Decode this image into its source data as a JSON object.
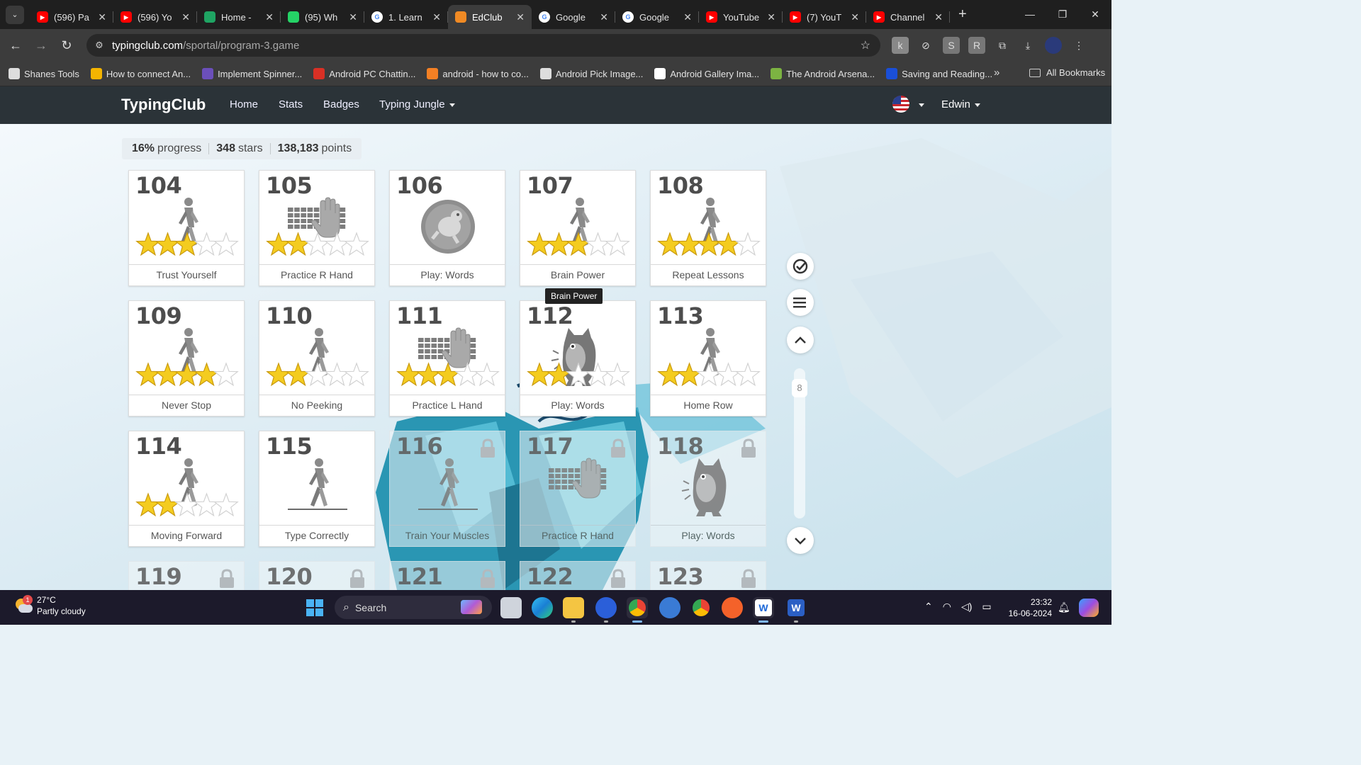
{
  "browser": {
    "tabs": [
      {
        "title": "(596) Pa",
        "fav": "youtube",
        "color": "#ff0000"
      },
      {
        "title": "(596) Yo",
        "fav": "youtube",
        "color": "#ff0000"
      },
      {
        "title": "Home -",
        "fav": "drive",
        "color": "#1fa463"
      },
      {
        "title": "(95) Wh",
        "fav": "whatsapp",
        "color": "#25d366"
      },
      {
        "title": "1. Learn",
        "fav": "google",
        "color": "#4285f4"
      },
      {
        "title": "EdClub",
        "fav": "edclub",
        "color": "#f08a24",
        "active": true
      },
      {
        "title": "Google",
        "fav": "google",
        "color": "#4285f4"
      },
      {
        "title": "Google",
        "fav": "google",
        "color": "#4285f4"
      },
      {
        "title": "YouTube",
        "fav": "youtube",
        "color": "#ff0000"
      },
      {
        "title": "(7) YouT",
        "fav": "youtube",
        "color": "#ff0000"
      },
      {
        "title": "Channel",
        "fav": "youtube",
        "color": "#ff0000"
      }
    ],
    "url_domain": "typingclub.com",
    "url_path": "/sportal/program-3.game",
    "bookmarks": [
      {
        "label": "Shanes Tools",
        "color": "#dddddd"
      },
      {
        "label": "How to connect An...",
        "color": "#f4b400"
      },
      {
        "label": "Implement Spinner...",
        "color": "#6b4fbb"
      },
      {
        "label": "Android  PC Chattin...",
        "color": "#d93025"
      },
      {
        "label": "android - how to co...",
        "color": "#f48024"
      },
      {
        "label": "Android Pick Image...",
        "color": "#dddddd"
      },
      {
        "label": "Android Gallery Ima...",
        "color": "#ffffff"
      },
      {
        "label": "The Android Arsena...",
        "color": "#7cb342"
      },
      {
        "label": "Saving and Reading...",
        "color": "#1a4fd8"
      }
    ],
    "all_bookmarks": "All Bookmarks"
  },
  "site": {
    "brand": "TypingClub",
    "nav": [
      "Home",
      "Stats",
      "Badges",
      "Typing Jungle"
    ],
    "user": "Edwin"
  },
  "progress": {
    "percent": "16%",
    "percent_label": "progress",
    "stars": "348",
    "stars_label": "stars",
    "points": "138,183",
    "points_label": "points"
  },
  "lessons": [
    {
      "num": "104",
      "label": "Trust Yourself",
      "type": "walker",
      "stars": 3,
      "locked": false
    },
    {
      "num": "105",
      "label": "Practice R Hand",
      "type": "keyboard",
      "stars": 2,
      "locked": false
    },
    {
      "num": "106",
      "label": "Play: Words",
      "type": "game",
      "stars": 0,
      "locked": false
    },
    {
      "num": "107",
      "label": "Brain Power",
      "type": "walker",
      "stars": 3,
      "locked": false
    },
    {
      "num": "108",
      "label": "Repeat Lessons",
      "type": "walker",
      "stars": 4,
      "locked": false
    },
    {
      "num": "109",
      "label": "Never Stop",
      "type": "walker",
      "stars": 4,
      "locked": false
    },
    {
      "num": "110",
      "label": "No Peeking",
      "type": "walker",
      "stars": 2,
      "locked": false
    },
    {
      "num": "111",
      "label": "Practice L Hand",
      "type": "keyboard",
      "stars": 3,
      "locked": false
    },
    {
      "num": "112",
      "label": "Play: Words",
      "type": "monster",
      "stars": 2,
      "locked": false
    },
    {
      "num": "113",
      "label": "Home Row",
      "type": "walker",
      "stars": 2,
      "locked": false
    },
    {
      "num": "114",
      "label": "Moving Forward",
      "type": "walker",
      "stars": 2,
      "locked": false
    },
    {
      "num": "115",
      "label": "Type Correctly",
      "type": "walker-line",
      "stars": -1,
      "locked": false
    },
    {
      "num": "116",
      "label": "Train Your Muscles",
      "type": "walker-line",
      "stars": -1,
      "locked": true
    },
    {
      "num": "117",
      "label": "Practice R Hand",
      "type": "keyboard",
      "stars": -1,
      "locked": true
    },
    {
      "num": "118",
      "label": "Play: Words",
      "type": "monster",
      "stars": -1,
      "locked": true
    },
    {
      "num": "119",
      "label": "",
      "type": "none",
      "stars": -1,
      "locked": true
    },
    {
      "num": "120",
      "label": "",
      "type": "none",
      "stars": -1,
      "locked": true
    },
    {
      "num": "121",
      "label": "",
      "type": "none",
      "stars": -1,
      "locked": true
    },
    {
      "num": "122",
      "label": "",
      "type": "none",
      "stars": -1,
      "locked": true
    },
    {
      "num": "123",
      "label": "",
      "type": "none",
      "stars": -1,
      "locked": true
    }
  ],
  "tooltip": "Brain Power",
  "sidebar": {
    "scroll_value": "8"
  },
  "taskbar": {
    "weather_temp": "27°C",
    "weather_desc": "Partly cloudy",
    "weather_badge": "1",
    "search_label": "Search",
    "time": "23:32",
    "date": "16-06-2024"
  }
}
